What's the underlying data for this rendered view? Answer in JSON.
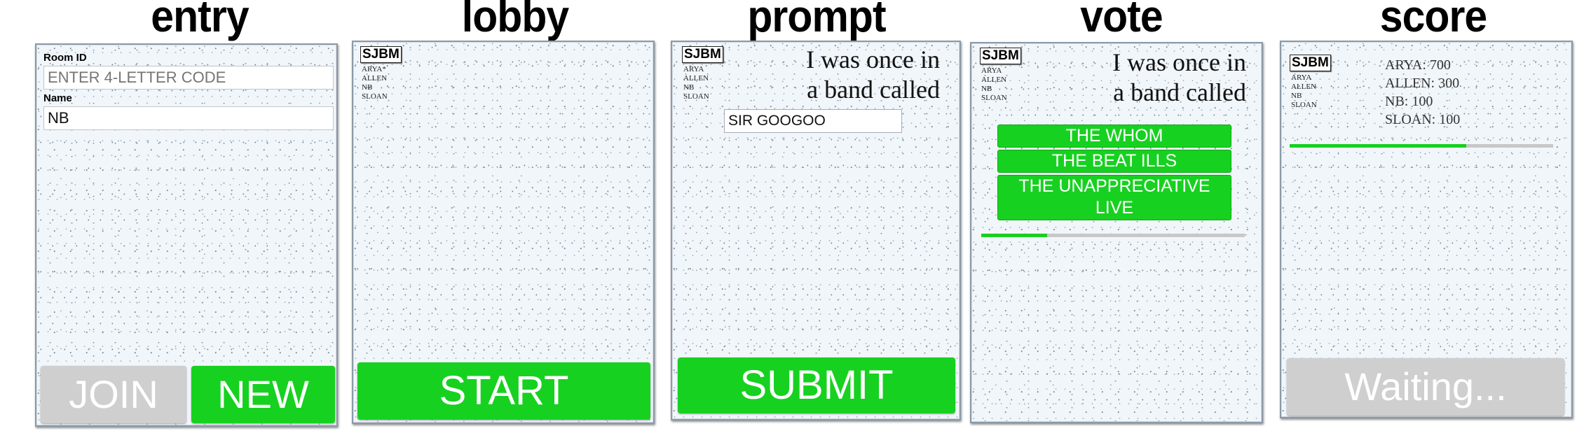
{
  "screens": {
    "entry": {
      "title": "entry",
      "room_label": "Room ID",
      "room_placeholder": "ENTER 4-LETTER CODE",
      "name_label": "Name",
      "name_value": "NB",
      "join_label": "JOIN",
      "new_label": "NEW"
    },
    "lobby": {
      "title": "lobby",
      "room_code": "SJBM",
      "players": [
        "ARYA*",
        "ALLEN",
        "NB",
        "SLOAN"
      ],
      "start_label": "START"
    },
    "prompt": {
      "title": "prompt",
      "room_code": "SJBM",
      "players": [
        "ARYA",
        "ALLEN",
        "NB",
        "SLOAN"
      ],
      "prompt_line1": "I was once in",
      "prompt_line2": "a band called",
      "answer_value": "SIR GOOGOO",
      "submit_label": "SUBMIT"
    },
    "vote": {
      "title": "vote",
      "room_code": "SJBM",
      "players": [
        "ARYA",
        "ALLEN",
        "NB",
        "SLOAN"
      ],
      "prompt_line1": "I was once in",
      "prompt_line2": "a band called",
      "options": [
        "THE WHOM",
        "THE BEAT ILLS",
        "THE UNAPPRECIATIVE",
        "LIVE"
      ],
      "timer_progress": 0.25
    },
    "score": {
      "title": "score",
      "room_code": "SJBM",
      "players": [
        "ARYA",
        "ALLEN",
        "NB",
        "SLOAN"
      ],
      "scores": [
        "ARYA: 700",
        "ALLEN: 300",
        "NB: 100",
        "SLOAN: 100"
      ],
      "timer_progress": 0.67,
      "waiting_label": "Waiting..."
    }
  },
  "colors": {
    "accent_green": "#17d120",
    "disabled_gray": "#cfcfcf"
  }
}
